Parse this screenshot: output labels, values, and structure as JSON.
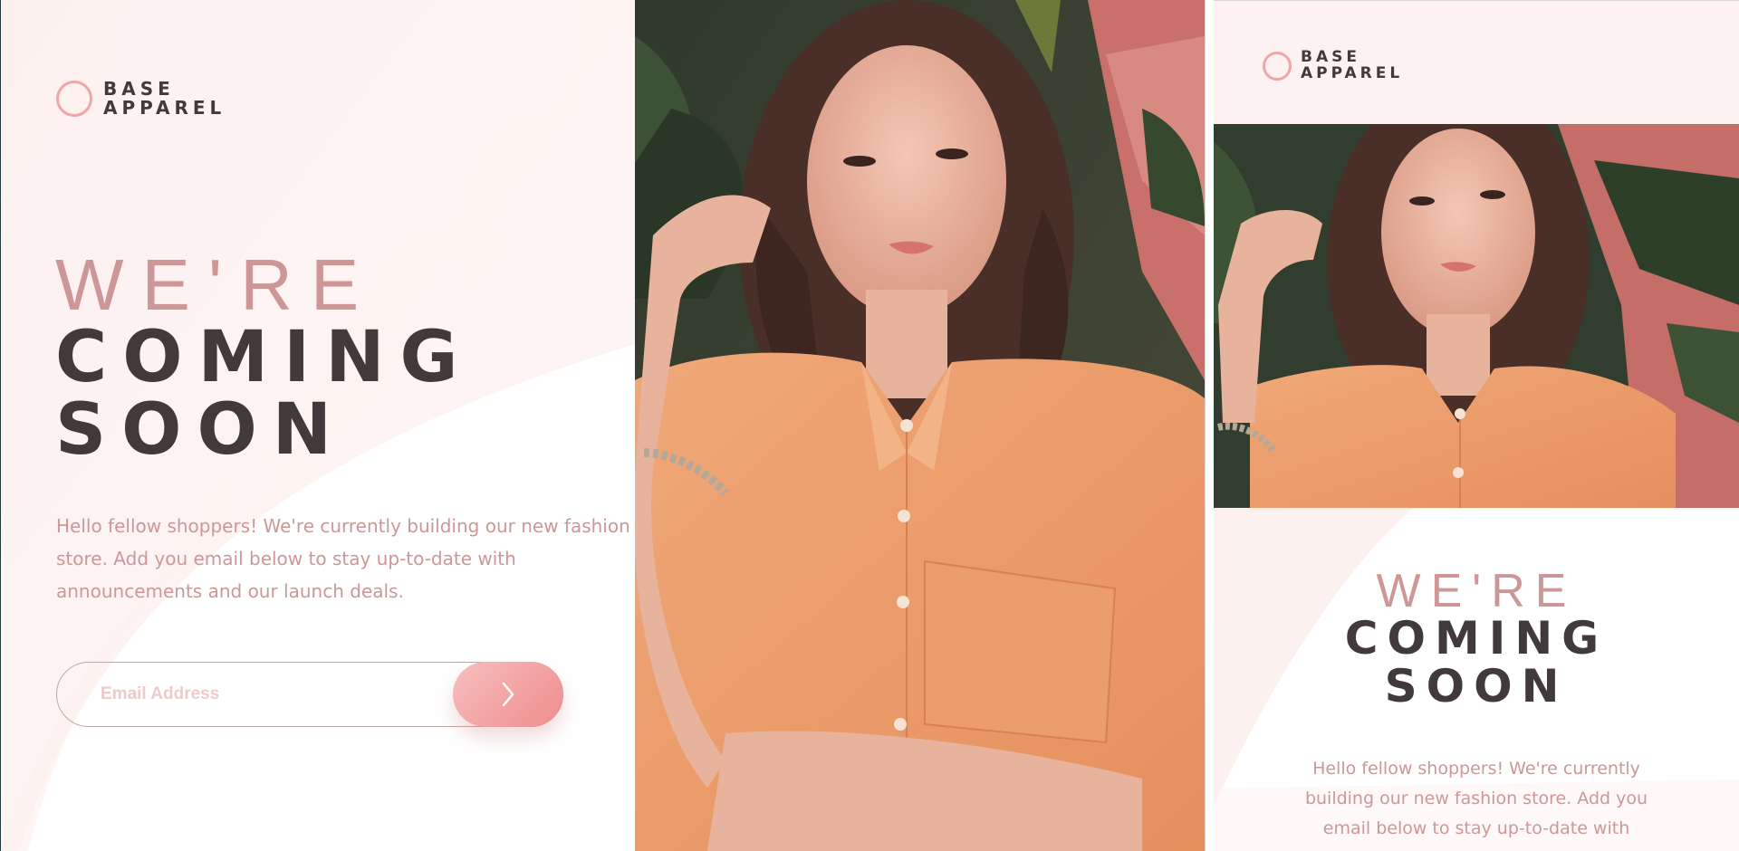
{
  "brand": {
    "line1": "BASE",
    "line2": "APPAREL"
  },
  "desktop": {
    "headline_light": "WE'RE",
    "headline_dark_1": "COMING",
    "headline_dark_2": "SOON",
    "intro": "Hello fellow shoppers! We're currently building our new fashion store. Add you email below to stay up-to-date with announcements and our launch deals.",
    "email": {
      "placeholder": "Email Address",
      "value": ""
    },
    "submit_icon": "chevron-right-icon",
    "hero_image": "woman-in-orange-shirt-photo"
  },
  "mobile": {
    "headline_light": "WE'RE",
    "headline_dark_1": "COMING",
    "headline_dark_2": "SOON",
    "intro": "Hello fellow shoppers! We're currently building our new fashion store. Add you email below to stay up-to-date with",
    "hero_image": "woman-in-orange-shirt-photo"
  },
  "colors": {
    "pink_background": "#fdf2f1",
    "rose": "#ce9797",
    "dark": "#423a3a",
    "accent_light": "#f8bfbf",
    "accent_dark": "#ee8c8c",
    "ring": "#f0a6a8"
  }
}
